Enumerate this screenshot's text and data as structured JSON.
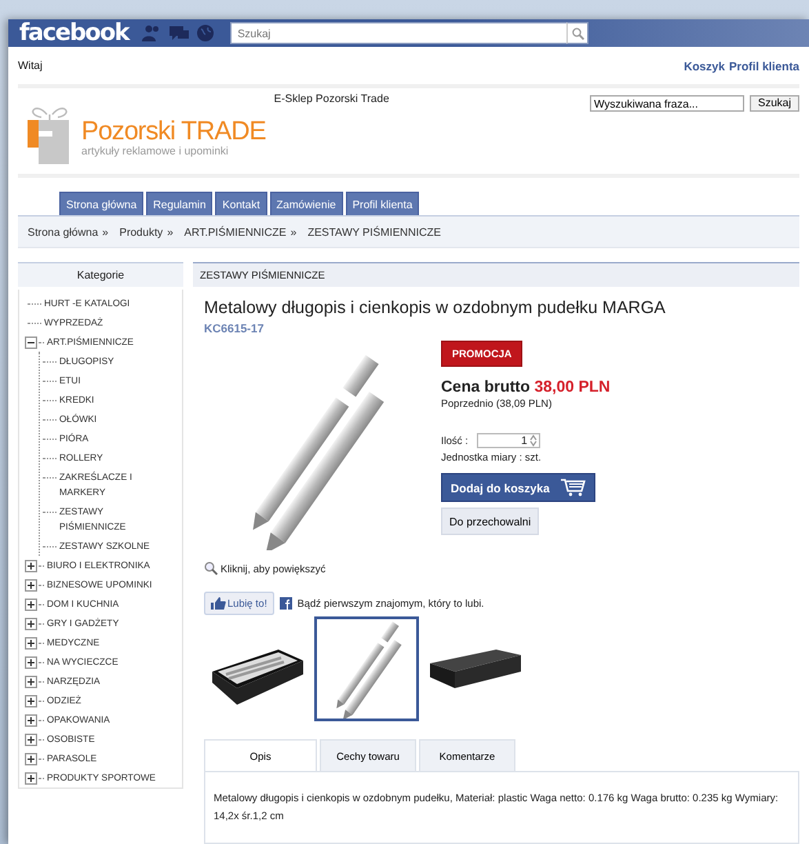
{
  "facebook_bar": {
    "logo": "facebook",
    "search": {
      "placeholder": "Szukaj"
    }
  },
  "top_bar": {
    "greeting": "Witaj",
    "links": [
      "Koszyk",
      "Profil klienta"
    ]
  },
  "header": {
    "shop_name": "E-Sklep Pozorski Trade",
    "logo_title": "Pozorski TRADE",
    "logo_subtitle": "artykuły reklamowe i upominki",
    "search": {
      "value": "Wyszukiwana fraza...",
      "button": "Szukaj"
    }
  },
  "nav": [
    {
      "label": "Strona główna"
    },
    {
      "label": "Regulamin"
    },
    {
      "label": "Kontakt"
    },
    {
      "label": "Zamówienie"
    },
    {
      "label": "Profil klienta"
    }
  ],
  "breadcrumb": [
    {
      "label": "Strona główna",
      "separator": "»"
    },
    {
      "label": "Produkty",
      "separator": "»"
    },
    {
      "label": "ART.PIŚMIENNICZE",
      "separator": "»"
    },
    {
      "label": "ZESTAWY PIŚMIENNICZE"
    }
  ],
  "sidebar": {
    "title": "Kategorie",
    "items": [
      {
        "label": "HURT -E KATALOGI",
        "kind": "leaf"
      },
      {
        "label": "WYPRZEDAŻ",
        "kind": "leaf"
      },
      {
        "label": "ART.PIŚMIENNICZE",
        "kind": "group",
        "expanded": true,
        "children": [
          {
            "label": "DŁUGOPISY"
          },
          {
            "label": "ETUI"
          },
          {
            "label": "KREDKI"
          },
          {
            "label": "OŁÓWKI"
          },
          {
            "label": "PIÓRA"
          },
          {
            "label": "ROLLERY"
          },
          {
            "label": "ZAKREŚLACZE I MARKERY"
          },
          {
            "label": "ZESTAWY PIŚMIENNICZE"
          },
          {
            "label": "ZESTAWY SZKOLNE"
          }
        ]
      },
      {
        "label": "BIURO I ELEKTRONIKA",
        "kind": "group",
        "expanded": false
      },
      {
        "label": "BIZNESOWE UPOMINKI",
        "kind": "group",
        "expanded": false
      },
      {
        "label": "DOM I KUCHNIA",
        "kind": "group",
        "expanded": false
      },
      {
        "label": "GRY I GADŻETY",
        "kind": "group",
        "expanded": false
      },
      {
        "label": "MEDYCZNE",
        "kind": "group",
        "expanded": false
      },
      {
        "label": "NA WYCIECZCE",
        "kind": "group",
        "expanded": false
      },
      {
        "label": "NARZĘDZIA",
        "kind": "group",
        "expanded": false
      },
      {
        "label": "ODZIEŻ",
        "kind": "group",
        "expanded": false
      },
      {
        "label": "OPAKOWANIA",
        "kind": "group",
        "expanded": false
      },
      {
        "label": "OSOBISTE",
        "kind": "group",
        "expanded": false
      },
      {
        "label": "PARASOLE",
        "kind": "group",
        "expanded": false
      },
      {
        "label": "PRODUKTY SPORTOWE",
        "kind": "group",
        "expanded": false
      }
    ]
  },
  "product": {
    "section_title": "ZESTAWY PIŚMIENNICZE",
    "name": "Metalowy długopis i cienkopis w ozdobnym pudełku MARGA",
    "code": "KC6615-17",
    "badge": "PROMOCJA",
    "price_label": "Cena brutto",
    "price": "38,00 PLN",
    "previous_price": "Poprzednio (38,09 PLN)",
    "quantity": {
      "label": "Ilość :",
      "value": "1"
    },
    "unit": "Jednostka miary : szt.",
    "add_to_cart": "Dodaj do koszyka",
    "wishlist": "Do przechowalni",
    "zoom_hint": "Kliknij, aby powiększyć",
    "like": {
      "button": "Lubię to!",
      "text": "Bądź pierwszym znajomym, który to lubi."
    },
    "thumbnails": [
      {
        "kind": "open-case",
        "selected": false
      },
      {
        "kind": "pens",
        "selected": true
      },
      {
        "kind": "closed-case",
        "selected": false
      }
    ],
    "tabs": [
      {
        "label": "Opis",
        "selected": true
      },
      {
        "label": "Cechy towaru",
        "selected": false
      },
      {
        "label": "Komentarze",
        "selected": false
      }
    ],
    "description": "Metalowy długopis i cienkopis w ozdobnym pudełku, Materiał: plastic Waga netto: 0.176 kg Waga brutto: 0.235 kg Wymiary: 14,2x śr.1,2 cm"
  }
}
